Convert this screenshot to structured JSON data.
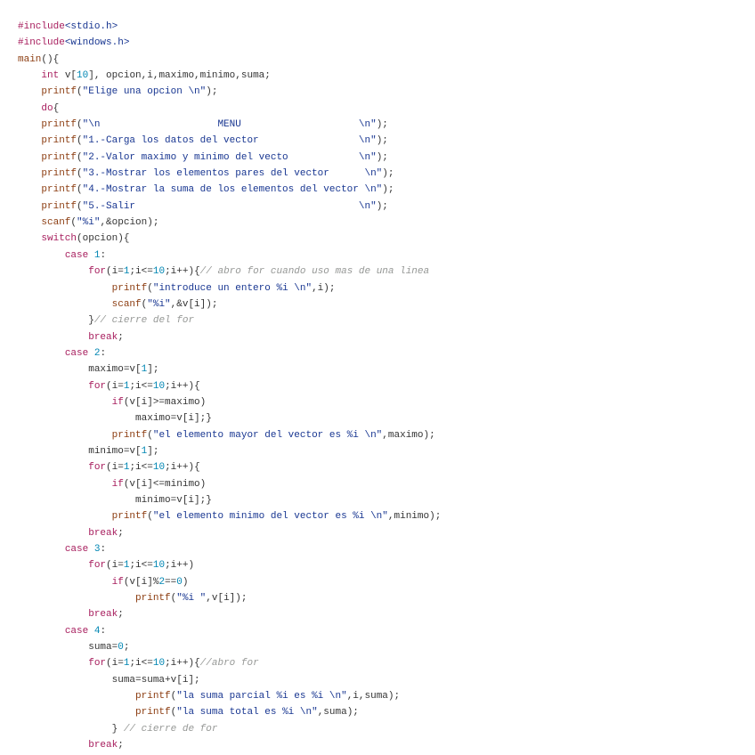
{
  "colors": {
    "background": "#ffffff",
    "plain": "#333333",
    "keyword": "#a71d5d",
    "function": "#8c3d11",
    "string": "#183691",
    "number": "#0086b3",
    "comment": "#969896"
  },
  "code": {
    "lines": [
      [
        {
          "t": "pp",
          "v": "#include"
        },
        {
          "t": "header",
          "v": "<stdio.h>"
        }
      ],
      [
        {
          "t": "pp",
          "v": "#include"
        },
        {
          "t": "header",
          "v": "<windows.h>"
        }
      ],
      [
        {
          "t": "fn",
          "v": "main"
        },
        {
          "t": "plain",
          "v": "(){"
        }
      ],
      [
        {
          "t": "plain",
          "v": "    "
        },
        {
          "t": "type",
          "v": "int"
        },
        {
          "t": "plain",
          "v": " v["
        },
        {
          "t": "num",
          "v": "10"
        },
        {
          "t": "plain",
          "v": "], opcion,i,maximo,minimo,suma;"
        }
      ],
      [
        {
          "t": "plain",
          "v": "    "
        },
        {
          "t": "fn",
          "v": "printf"
        },
        {
          "t": "plain",
          "v": "("
        },
        {
          "t": "str",
          "v": "\"Elige una opcion \\n\""
        },
        {
          "t": "plain",
          "v": ");"
        }
      ],
      [
        {
          "t": "plain",
          "v": "    "
        },
        {
          "t": "kw",
          "v": "do"
        },
        {
          "t": "plain",
          "v": "{"
        }
      ],
      [
        {
          "t": "plain",
          "v": "    "
        },
        {
          "t": "fn",
          "v": "printf"
        },
        {
          "t": "plain",
          "v": "("
        },
        {
          "t": "str",
          "v": "\"\\n                    MENU                    \\n\""
        },
        {
          "t": "plain",
          "v": ");"
        }
      ],
      [
        {
          "t": "plain",
          "v": "    "
        },
        {
          "t": "fn",
          "v": "printf"
        },
        {
          "t": "plain",
          "v": "("
        },
        {
          "t": "str",
          "v": "\"1.-Carga los datos del vector                 \\n\""
        },
        {
          "t": "plain",
          "v": ");"
        }
      ],
      [
        {
          "t": "plain",
          "v": "    "
        },
        {
          "t": "fn",
          "v": "printf"
        },
        {
          "t": "plain",
          "v": "("
        },
        {
          "t": "str",
          "v": "\"2.-Valor maximo y minimo del vecto            \\n\""
        },
        {
          "t": "plain",
          "v": ");"
        }
      ],
      [
        {
          "t": "plain",
          "v": "    "
        },
        {
          "t": "fn",
          "v": "printf"
        },
        {
          "t": "plain",
          "v": "("
        },
        {
          "t": "str",
          "v": "\"3.-Mostrar los elementos pares del vector      \\n\""
        },
        {
          "t": "plain",
          "v": ");"
        }
      ],
      [
        {
          "t": "plain",
          "v": "    "
        },
        {
          "t": "fn",
          "v": "printf"
        },
        {
          "t": "plain",
          "v": "("
        },
        {
          "t": "str",
          "v": "\"4.-Mostrar la suma de los elementos del vector \\n\""
        },
        {
          "t": "plain",
          "v": ");"
        }
      ],
      [
        {
          "t": "plain",
          "v": "    "
        },
        {
          "t": "fn",
          "v": "printf"
        },
        {
          "t": "plain",
          "v": "("
        },
        {
          "t": "str",
          "v": "\"5.-Salir                                      \\n\""
        },
        {
          "t": "plain",
          "v": ");"
        }
      ],
      [
        {
          "t": "plain",
          "v": "    "
        },
        {
          "t": "fn",
          "v": "scanf"
        },
        {
          "t": "plain",
          "v": "("
        },
        {
          "t": "str",
          "v": "\"%i\""
        },
        {
          "t": "plain",
          "v": ",&opcion);"
        }
      ],
      [
        {
          "t": "plain",
          "v": "    "
        },
        {
          "t": "kw",
          "v": "switch"
        },
        {
          "t": "plain",
          "v": "(opcion){"
        }
      ],
      [
        {
          "t": "plain",
          "v": "        "
        },
        {
          "t": "kw",
          "v": "case"
        },
        {
          "t": "plain",
          "v": " "
        },
        {
          "t": "num",
          "v": "1"
        },
        {
          "t": "plain",
          "v": ":"
        }
      ],
      [
        {
          "t": "plain",
          "v": "            "
        },
        {
          "t": "kw",
          "v": "for"
        },
        {
          "t": "plain",
          "v": "(i="
        },
        {
          "t": "num",
          "v": "1"
        },
        {
          "t": "plain",
          "v": ";i<="
        },
        {
          "t": "num",
          "v": "10"
        },
        {
          "t": "plain",
          "v": ";i++){"
        },
        {
          "t": "comment",
          "v": "// abro for cuando uso mas de una linea"
        }
      ],
      [
        {
          "t": "plain",
          "v": "                "
        },
        {
          "t": "fn",
          "v": "printf"
        },
        {
          "t": "plain",
          "v": "("
        },
        {
          "t": "str",
          "v": "\"introduce un entero %i \\n\""
        },
        {
          "t": "plain",
          "v": ",i);"
        }
      ],
      [
        {
          "t": "plain",
          "v": "                "
        },
        {
          "t": "fn",
          "v": "scanf"
        },
        {
          "t": "plain",
          "v": "("
        },
        {
          "t": "str",
          "v": "\"%i\""
        },
        {
          "t": "plain",
          "v": ",&v[i]);"
        }
      ],
      [
        {
          "t": "plain",
          "v": "            }"
        },
        {
          "t": "comment",
          "v": "// cierre del for"
        }
      ],
      [
        {
          "t": "plain",
          "v": "            "
        },
        {
          "t": "kw",
          "v": "break"
        },
        {
          "t": "plain",
          "v": ";"
        }
      ],
      [
        {
          "t": "plain",
          "v": "        "
        },
        {
          "t": "kw",
          "v": "case"
        },
        {
          "t": "plain",
          "v": " "
        },
        {
          "t": "num",
          "v": "2"
        },
        {
          "t": "plain",
          "v": ":"
        }
      ],
      [
        {
          "t": "plain",
          "v": "            maximo=v["
        },
        {
          "t": "num",
          "v": "1"
        },
        {
          "t": "plain",
          "v": "];"
        }
      ],
      [
        {
          "t": "plain",
          "v": "            "
        },
        {
          "t": "kw",
          "v": "for"
        },
        {
          "t": "plain",
          "v": "(i="
        },
        {
          "t": "num",
          "v": "1"
        },
        {
          "t": "plain",
          "v": ";i<="
        },
        {
          "t": "num",
          "v": "10"
        },
        {
          "t": "plain",
          "v": ";i++){"
        }
      ],
      [
        {
          "t": "plain",
          "v": "                "
        },
        {
          "t": "kw",
          "v": "if"
        },
        {
          "t": "plain",
          "v": "(v[i]>=maximo)"
        }
      ],
      [
        {
          "t": "plain",
          "v": "                    maximo=v[i];}"
        }
      ],
      [
        {
          "t": "plain",
          "v": "                "
        },
        {
          "t": "fn",
          "v": "printf"
        },
        {
          "t": "plain",
          "v": "("
        },
        {
          "t": "str",
          "v": "\"el elemento mayor del vector es %i \\n\""
        },
        {
          "t": "plain",
          "v": ",maximo);"
        }
      ],
      [
        {
          "t": "plain",
          "v": "            minimo=v["
        },
        {
          "t": "num",
          "v": "1"
        },
        {
          "t": "plain",
          "v": "];"
        }
      ],
      [
        {
          "t": "plain",
          "v": "            "
        },
        {
          "t": "kw",
          "v": "for"
        },
        {
          "t": "plain",
          "v": "(i="
        },
        {
          "t": "num",
          "v": "1"
        },
        {
          "t": "plain",
          "v": ";i<="
        },
        {
          "t": "num",
          "v": "10"
        },
        {
          "t": "plain",
          "v": ";i++){"
        }
      ],
      [
        {
          "t": "plain",
          "v": "                "
        },
        {
          "t": "kw",
          "v": "if"
        },
        {
          "t": "plain",
          "v": "(v[i]<=minimo)"
        }
      ],
      [
        {
          "t": "plain",
          "v": "                    minimo=v[i];}"
        }
      ],
      [
        {
          "t": "plain",
          "v": "                "
        },
        {
          "t": "fn",
          "v": "printf"
        },
        {
          "t": "plain",
          "v": "("
        },
        {
          "t": "str",
          "v": "\"el elemento minimo del vector es %i \\n\""
        },
        {
          "t": "plain",
          "v": ",minimo);"
        }
      ],
      [
        {
          "t": "plain",
          "v": "            "
        },
        {
          "t": "kw",
          "v": "break"
        },
        {
          "t": "plain",
          "v": ";"
        }
      ],
      [
        {
          "t": "plain",
          "v": "        "
        },
        {
          "t": "kw",
          "v": "case"
        },
        {
          "t": "plain",
          "v": " "
        },
        {
          "t": "num",
          "v": "3"
        },
        {
          "t": "plain",
          "v": ":"
        }
      ],
      [
        {
          "t": "plain",
          "v": "            "
        },
        {
          "t": "kw",
          "v": "for"
        },
        {
          "t": "plain",
          "v": "(i="
        },
        {
          "t": "num",
          "v": "1"
        },
        {
          "t": "plain",
          "v": ";i<="
        },
        {
          "t": "num",
          "v": "10"
        },
        {
          "t": "plain",
          "v": ";i++)"
        }
      ],
      [
        {
          "t": "plain",
          "v": "                "
        },
        {
          "t": "kw",
          "v": "if"
        },
        {
          "t": "plain",
          "v": "(v[i]%"
        },
        {
          "t": "num",
          "v": "2"
        },
        {
          "t": "plain",
          "v": "=="
        },
        {
          "t": "num",
          "v": "0"
        },
        {
          "t": "plain",
          "v": ")"
        }
      ],
      [
        {
          "t": "plain",
          "v": "                    "
        },
        {
          "t": "fn",
          "v": "printf"
        },
        {
          "t": "plain",
          "v": "("
        },
        {
          "t": "str",
          "v": "\"%i \""
        },
        {
          "t": "plain",
          "v": ",v[i]);"
        }
      ],
      [
        {
          "t": "plain",
          "v": "            "
        },
        {
          "t": "kw",
          "v": "break"
        },
        {
          "t": "plain",
          "v": ";"
        }
      ],
      [
        {
          "t": "plain",
          "v": "        "
        },
        {
          "t": "kw",
          "v": "case"
        },
        {
          "t": "plain",
          "v": " "
        },
        {
          "t": "num",
          "v": "4"
        },
        {
          "t": "plain",
          "v": ":"
        }
      ],
      [
        {
          "t": "plain",
          "v": "            suma="
        },
        {
          "t": "num",
          "v": "0"
        },
        {
          "t": "plain",
          "v": ";"
        }
      ],
      [
        {
          "t": "plain",
          "v": "            "
        },
        {
          "t": "kw",
          "v": "for"
        },
        {
          "t": "plain",
          "v": "(i="
        },
        {
          "t": "num",
          "v": "1"
        },
        {
          "t": "plain",
          "v": ";i<="
        },
        {
          "t": "num",
          "v": "10"
        },
        {
          "t": "plain",
          "v": ";i++){"
        },
        {
          "t": "comment",
          "v": "//abro for"
        }
      ],
      [
        {
          "t": "plain",
          "v": "                suma=suma+v[i];"
        }
      ],
      [
        {
          "t": "plain",
          "v": "                    "
        },
        {
          "t": "fn",
          "v": "printf"
        },
        {
          "t": "plain",
          "v": "("
        },
        {
          "t": "str",
          "v": "\"la suma parcial %i es %i \\n\""
        },
        {
          "t": "plain",
          "v": ",i,suma);"
        }
      ],
      [
        {
          "t": "plain",
          "v": "                    "
        },
        {
          "t": "fn",
          "v": "printf"
        },
        {
          "t": "plain",
          "v": "("
        },
        {
          "t": "str",
          "v": "\"la suma total es %i \\n\""
        },
        {
          "t": "plain",
          "v": ",suma);"
        }
      ],
      [
        {
          "t": "plain",
          "v": "                } "
        },
        {
          "t": "comment",
          "v": "// cierre de for"
        }
      ],
      [
        {
          "t": "plain",
          "v": "            "
        },
        {
          "t": "kw",
          "v": "break"
        },
        {
          "t": "plain",
          "v": ";"
        }
      ]
    ]
  }
}
